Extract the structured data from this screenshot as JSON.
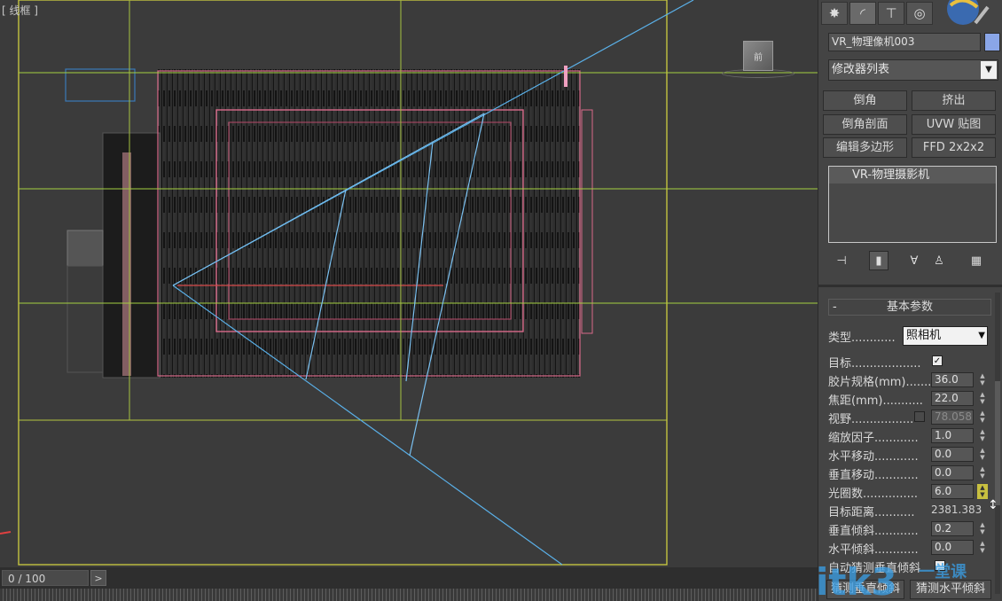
{
  "viewport": {
    "label": "[ 线框 ]",
    "cube_label": "前"
  },
  "timeline": {
    "frame": "0 / 100",
    "next": ">"
  },
  "panel": {
    "tabs": [
      "create-icon",
      "modify-icon",
      "hierarchy-icon",
      "motion-icon"
    ],
    "object_name": "VR_物理像机003",
    "object_color": "#8aa6e8",
    "modifier_list": "修改器列表",
    "modifier_buttons": [
      {
        "label": "倒角"
      },
      {
        "label": "挤出"
      },
      {
        "label": "倒角剖面"
      },
      {
        "label": "UVW 贴图"
      },
      {
        "label": "编辑多边形"
      },
      {
        "label": "FFD 2x2x2"
      }
    ],
    "stack_items": [
      "VR-物理摄影机"
    ],
    "rollout_title": "基本参数",
    "rollout_minus": "-",
    "params": {
      "type_label": "类型............",
      "type_value": "照相机",
      "target_label": "目标...................",
      "film_label": "胶片规格(mm).......",
      "film_value": "36.0",
      "focal_label": "焦距(mm)...........",
      "focal_value": "22.0",
      "fov_label": "视野.................",
      "fov_value": "78.058",
      "zoom_label": "缩放因子............",
      "zoom_value": "1.0",
      "hshift_label": "水平移动............",
      "hshift_value": "0.0",
      "vshift_label": "垂直移动............",
      "vshift_value": "0.0",
      "fnum_label": "光圈数...............",
      "fnum_value": "6.0",
      "tdist_label": "目标距离...........",
      "tdist_value": "2381.383",
      "vtilt_label": "垂直倾斜............",
      "vtilt_value": "0.2",
      "htilt_label": "水平倾斜............",
      "htilt_value": "0.0",
      "auto_label": "自动猜测垂直倾斜"
    },
    "bottom_buttons": [
      {
        "label": "猜测垂直倾斜"
      },
      {
        "label": "猜测水平倾斜"
      }
    ]
  },
  "watermark": {
    "text": "itk3",
    "subtext": "一堂课"
  }
}
